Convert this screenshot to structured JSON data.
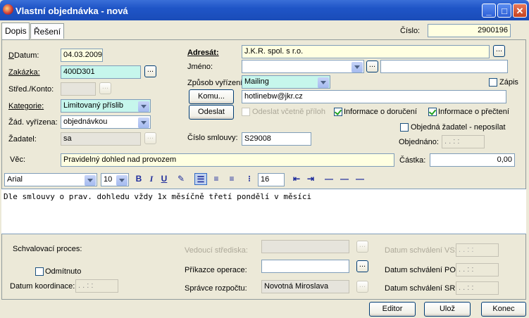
{
  "window": {
    "title": "Vlastní objednávka - nová"
  },
  "tabs": [
    {
      "label": "Dopis"
    },
    {
      "label": "Řešení"
    }
  ],
  "cislo": {
    "label": "Číslo:",
    "value": "2900196"
  },
  "left": {
    "datum": {
      "label": "Datum:",
      "value": "04.03.2009"
    },
    "zakazka": {
      "label": "Zakázka:",
      "value": "400D301"
    },
    "stredisko": {
      "label": "Střed./Konto:",
      "value": ""
    },
    "kategorie": {
      "label": "Kategorie:",
      "value": "Limitovaný příslib"
    },
    "zad_vyrizena": {
      "label": "Žád. vyřízena:",
      "value": "objednávkou"
    },
    "zadatel": {
      "label": "Žadatel:",
      "value": "sa"
    }
  },
  "right": {
    "adresat": {
      "label": "Adresát:",
      "value": "J.K.R. spol. s r.o."
    },
    "jmeno": {
      "label": "Jméno:",
      "value": ""
    },
    "zpusob": {
      "label": "Způsob vyřízení:",
      "value": "Mailing"
    },
    "zapis": {
      "label": "Zápis",
      "checked": false
    },
    "komu": {
      "label": "Komu...",
      "value": "hotlinebw@jkr.cz"
    },
    "odeslat": {
      "label": "Odeslat"
    },
    "odeslat_vcetne": {
      "label": "Odeslat včetně příloh",
      "checked": false
    },
    "info_doruceni": {
      "label": "Informace o doručení",
      "checked": true
    },
    "info_precteni": {
      "label": "Informace o přečtení",
      "checked": true
    },
    "objednana_zadatel": {
      "label": "Objedná žadatel - neposílat",
      "checked": false
    },
    "objednano": {
      "label": "Objednáno:",
      "value": ". .   : :"
    },
    "cislo_smlouvy": {
      "label": "Číslo smlouvy:",
      "value": "S29008"
    }
  },
  "vec": {
    "label": "Věc:",
    "value": "Pravidelný dohled nad provozem"
  },
  "castka": {
    "label": "Částka:",
    "value": "0,00"
  },
  "toolbar": {
    "font": "Arial",
    "size": "10",
    "bold": "B",
    "italic": "I",
    "underline": "U",
    "indent": "16"
  },
  "editor": {
    "text": "Dle smlouvy o prav. dohledu vždy 1x měsíčně třetí pondělí v měsíci"
  },
  "bottom": {
    "schvalovaci": {
      "label": "Schvalovací proces:"
    },
    "odmitnuto": {
      "label": "Odmítnuto",
      "checked": false
    },
    "datum_koordinace": {
      "label": "Datum koordinace:",
      "value": ". .   : :"
    },
    "vedouci": {
      "label": "Vedoucí střediska:",
      "value": ""
    },
    "prikazce": {
      "label": "Příkazce operace:",
      "value": ""
    },
    "spravce": {
      "label": "Správce rozpočtu:",
      "value": "Novotná Miroslava"
    },
    "schvaleni_vs": {
      "label": "Datum schválení VS:",
      "value": ". .   : :"
    },
    "schvaleni_po": {
      "label": "Datum schválení PO:",
      "value": ". .   : :"
    },
    "schvaleni_sr": {
      "label": "Datum schválení SR:",
      "value": ". .   : :"
    }
  },
  "buttons": {
    "editor": "Editor",
    "uloz": "Ulož",
    "konec": "Konec"
  },
  "colors": {
    "titlebar": "#1f55c7",
    "yellow_field": "#ffffe1",
    "cyan_field": "#c6f6ec",
    "window_bg": "#ece9d8"
  }
}
